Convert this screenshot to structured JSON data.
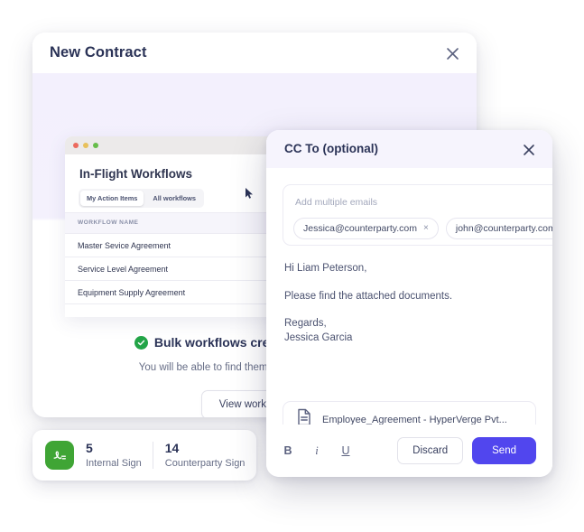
{
  "contract_card": {
    "title": "New Contract",
    "close_icon": "close-icon",
    "preview": {
      "window_dots": [
        "red",
        "yellow",
        "green"
      ],
      "heading": "In-Flight Workflows",
      "pills": [
        {
          "label": "My Action Items",
          "active": true
        },
        {
          "label": "All workflows",
          "active": false
        }
      ],
      "cursor_icon": "mouse-cursor-icon",
      "table": {
        "columns": [
          "WORKFLOW NAME"
        ],
        "rows": [
          "Master Sevice Agreement",
          "Service Level Agreement",
          "Equipment Supply Agreement"
        ]
      }
    },
    "success": {
      "check_icon": "check-circle-icon",
      "heading": "Bulk workflows created successfully",
      "subtext": "You will be able to find them in the workflows page",
      "button_label": "View workflows"
    }
  },
  "stats_card": {
    "icon": "signature-icon",
    "items": [
      {
        "value": "5",
        "label": "Internal Sign"
      },
      {
        "value": "14",
        "label": "Counterparty Sign"
      }
    ]
  },
  "cc_dialog": {
    "title": "CC To (optional)",
    "close_icon": "close-icon",
    "email_input": {
      "placeholder": "Add multiple emails",
      "chips": [
        {
          "email": "Jessica@counterparty.com",
          "remove_icon": "×"
        },
        {
          "email": "john@counterparty.com",
          "remove_icon": "×"
        }
      ]
    },
    "message": {
      "greeting": "Hi Liam Peterson,",
      "body": "Please find the attached documents.",
      "signoff": "Regards,",
      "sender": "Jessica Garcia"
    },
    "attachment": {
      "icon": "document-icon",
      "name": "Employee_Agreement - HyperVerge Pvt..."
    },
    "toolbar": {
      "bold": "B",
      "italic": "i",
      "underline": "U",
      "discard_label": "Discard",
      "send_label": "Send"
    }
  },
  "colors": {
    "accent_purple": "#5146ee",
    "success_green": "#22a447",
    "signature_green": "#3fa535",
    "header_lavender": "#f6f4fd",
    "text_dark": "#2b3357"
  }
}
